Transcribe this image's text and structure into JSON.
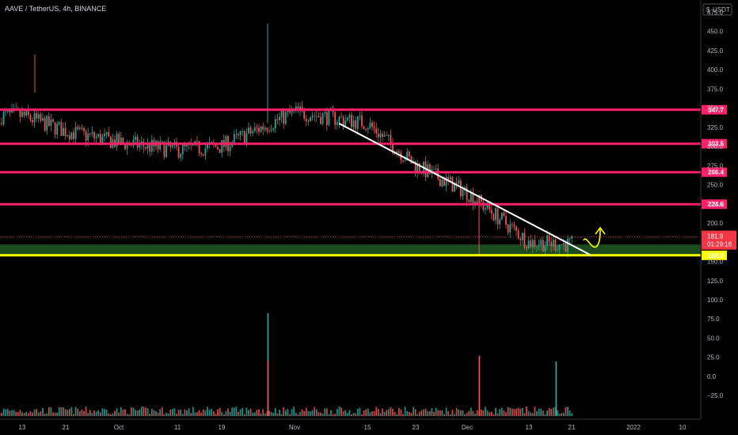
{
  "header": {
    "title": "AAVE / TetherUS, 4h, BINANCE",
    "currency_button": "USDT",
    "currency_prefix": "$"
  },
  "price_axis": {
    "tick_labels": [
      "475.0",
      "450.0",
      "425.0",
      "400.0",
      "375.0",
      "350.0",
      "325.0",
      "300.0",
      "275.0",
      "250.0",
      "225.0",
      "200.0",
      "175.0",
      "150.0",
      "125.0",
      "100.0",
      "75.0",
      "50.0",
      "25.0",
      "0.0",
      "−25.0"
    ]
  },
  "time_axis": {
    "tick_labels": [
      "13",
      "21",
      "Oct",
      "11",
      "19",
      "Nov",
      "15",
      "23",
      "Dec",
      "13",
      "21",
      "2022",
      "10"
    ]
  },
  "levels": [
    {
      "label": "347.7",
      "value": 347.7,
      "color": "#ff1f6a"
    },
    {
      "label": "303.5",
      "value": 303.5,
      "color": "#ff1f6a"
    },
    {
      "label": "266.4",
      "value": 266.4,
      "color": "#ff1f6a"
    },
    {
      "label": "224.6",
      "value": 224.6,
      "color": "#ff1f6a"
    }
  ],
  "support": {
    "label": "158.0",
    "value": 158.0,
    "color": "#ffff00",
    "zone_color": "#2e7d32"
  },
  "current_price": {
    "label": "181.9",
    "countdown": "01:29:16",
    "color": "#f23645"
  },
  "colors": {
    "up": "#26a69a",
    "down": "#ef5350",
    "background": "#000000",
    "trendline": "#ffffff",
    "arrow": "#ffff00"
  },
  "chart_data": {
    "type": "candlestick",
    "title": "AAVE / TetherUS, 4h, BINANCE",
    "x": [
      "13",
      "21",
      "Oct",
      "11",
      "19",
      "Nov",
      "15",
      "23",
      "Dec",
      "13",
      "21"
    ],
    "close": [
      340,
      320,
      305,
      295,
      300,
      345,
      330,
      275,
      240,
      175,
      172
    ],
    "approx_high": [
      365,
      420,
      330,
      315,
      320,
      460,
      350,
      290,
      270,
      200,
      195
    ],
    "approx_low": [
      305,
      260,
      255,
      270,
      285,
      300,
      290,
      225,
      220,
      150,
      155
    ],
    "indicator_values": [
      347.7,
      303.5,
      266.4,
      224.6,
      158.0
    ],
    "last_price": 181.9,
    "volume_peak": 108,
    "ylim": [
      -30,
      490
    ],
    "legend": "none",
    "grid": false
  }
}
